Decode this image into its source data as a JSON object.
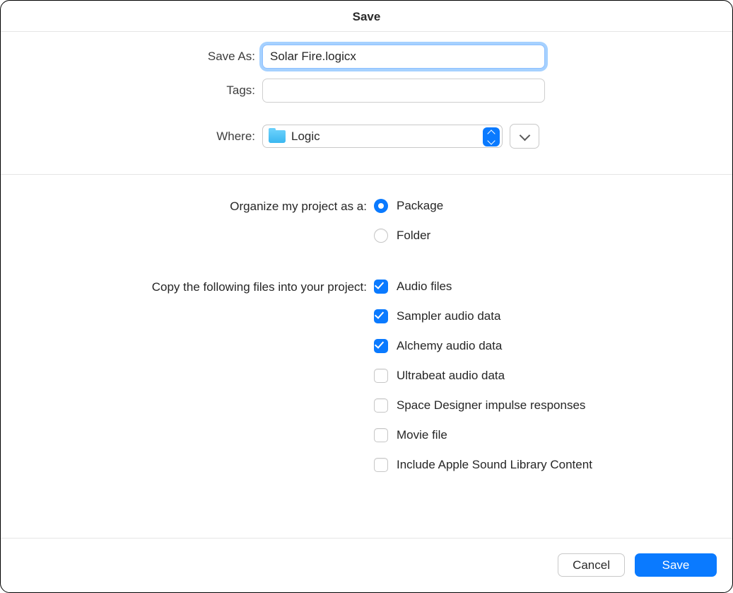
{
  "title": "Save",
  "labels": {
    "save_as": "Save As:",
    "tags": "Tags:",
    "where": "Where:",
    "organize": "Organize my project as a:",
    "copy_files": "Copy the following files into your project:"
  },
  "fields": {
    "save_as_value": "Solar Fire.logicx",
    "tags_value": "",
    "where_value": "Logic"
  },
  "organize": {
    "package": {
      "label": "Package",
      "selected": true
    },
    "folder": {
      "label": "Folder",
      "selected": false
    }
  },
  "copy_checks": [
    {
      "label": "Audio files",
      "checked": true
    },
    {
      "label": "Sampler audio data",
      "checked": true
    },
    {
      "label": "Alchemy audio data",
      "checked": true
    },
    {
      "label": "Ultrabeat audio data",
      "checked": false
    },
    {
      "label": "Space Designer impulse responses",
      "checked": false
    },
    {
      "label": "Movie file",
      "checked": false
    },
    {
      "label": "Include Apple Sound Library Content",
      "checked": false
    }
  ],
  "buttons": {
    "cancel": "Cancel",
    "save": "Save"
  }
}
